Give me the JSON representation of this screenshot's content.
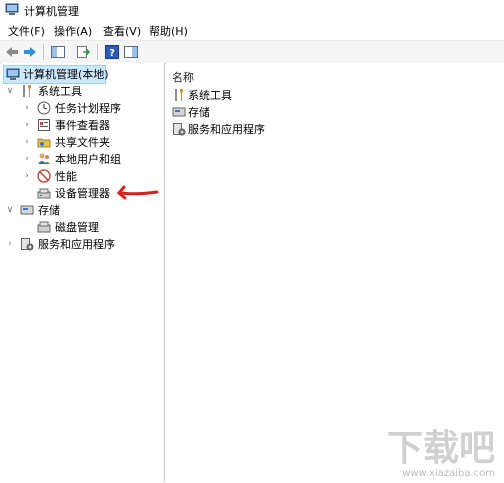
{
  "window": {
    "title": "计算机管理"
  },
  "menu": [
    "文件(F)",
    "操作(A)",
    "查看(V)",
    "帮助(H)"
  ],
  "toolbar": {
    "help_glyph": "?"
  },
  "tree": {
    "root": "计算机管理(本地)",
    "system_tools": "系统工具",
    "system_children": [
      "任务计划程序",
      "事件查看器",
      "共享文件夹",
      "本地用户和组",
      "性能",
      "设备管理器"
    ],
    "storage": "存储",
    "storage_children": [
      "磁盘管理"
    ],
    "services": "服务和应用程序"
  },
  "list": {
    "column_name": "名称",
    "items": [
      "系统工具",
      "存储",
      "服务和应用程序"
    ]
  },
  "watermark": {
    "text": "下载吧",
    "url": "www.xiazaiba.com"
  },
  "colors": {
    "selection": "#cce8ff",
    "annotation_arrow": "#d62020",
    "watermark": "#b8b8b8"
  }
}
